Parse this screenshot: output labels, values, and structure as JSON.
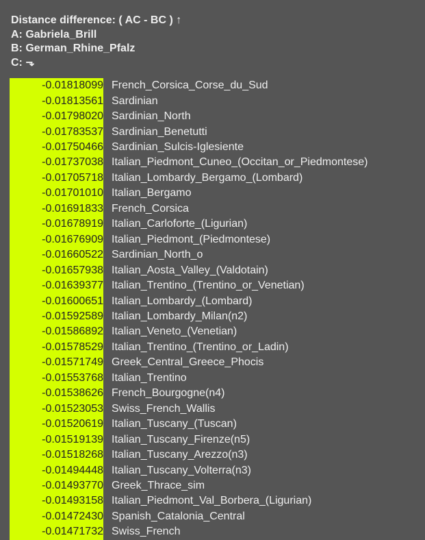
{
  "header": {
    "title": "Distance difference: ( AC - BC ) ↑",
    "a": "A: Gabriela_Brill",
    "b": "B: German_Rhine_Pfalz",
    "c": "C: ⬎"
  },
  "colors": {
    "background": "#555555",
    "value_highlight": "#d4ff00",
    "text": "#eeeeee"
  },
  "rows": [
    {
      "value": "-0.01818099",
      "name": "French_Corsica_Corse_du_Sud"
    },
    {
      "value": "-0.01813561",
      "name": "Sardinian"
    },
    {
      "value": "-0.01798020",
      "name": "Sardinian_North"
    },
    {
      "value": "-0.01783537",
      "name": "Sardinian_Benetutti"
    },
    {
      "value": "-0.01750466",
      "name": "Sardinian_Sulcis-Iglesiente"
    },
    {
      "value": "-0.01737038",
      "name": "Italian_Piedmont_Cuneo_(Occitan_or_Piedmontese)"
    },
    {
      "value": "-0.01705718",
      "name": "Italian_Lombardy_Bergamo_(Lombard)"
    },
    {
      "value": "-0.01701010",
      "name": "Italian_Bergamo"
    },
    {
      "value": "-0.01691833",
      "name": "French_Corsica"
    },
    {
      "value": "-0.01678919",
      "name": "Italian_Carloforte_(Ligurian)"
    },
    {
      "value": "-0.01676909",
      "name": "Italian_Piedmont_(Piedmontese)"
    },
    {
      "value": "-0.01660522",
      "name": "Sardinian_North_o"
    },
    {
      "value": "-0.01657938",
      "name": "Italian_Aosta_Valley_(Valdotain)"
    },
    {
      "value": "-0.01639377",
      "name": "Italian_Trentino_(Trentino_or_Venetian)"
    },
    {
      "value": "-0.01600651",
      "name": "Italian_Lombardy_(Lombard)"
    },
    {
      "value": "-0.01592589",
      "name": "Italian_Lombardy_Milan(n2)"
    },
    {
      "value": "-0.01586892",
      "name": "Italian_Veneto_(Venetian)"
    },
    {
      "value": "-0.01578529",
      "name": "Italian_Trentino_(Trentino_or_Ladin)"
    },
    {
      "value": "-0.01571749",
      "name": "Greek_Central_Greece_Phocis"
    },
    {
      "value": "-0.01553768",
      "name": "Italian_Trentino"
    },
    {
      "value": "-0.01538626",
      "name": "French_Bourgogne(n4)"
    },
    {
      "value": "-0.01523053",
      "name": "Swiss_French_Wallis"
    },
    {
      "value": "-0.01520619",
      "name": "Italian_Tuscany_(Tuscan)"
    },
    {
      "value": "-0.01519139",
      "name": "Italian_Tuscany_Firenze(n5)"
    },
    {
      "value": "-0.01518268",
      "name": "Italian_Tuscany_Arezzo(n3)"
    },
    {
      "value": "-0.01494448",
      "name": "Italian_Tuscany_Volterra(n3)"
    },
    {
      "value": "-0.01493770",
      "name": "Greek_Thrace_sim"
    },
    {
      "value": "-0.01493158",
      "name": "Italian_Piedmont_Val_Borbera_(Ligurian)"
    },
    {
      "value": "-0.01472430",
      "name": "Spanish_Catalonia_Central"
    },
    {
      "value": "-0.01471732",
      "name": "Swiss_French"
    }
  ]
}
